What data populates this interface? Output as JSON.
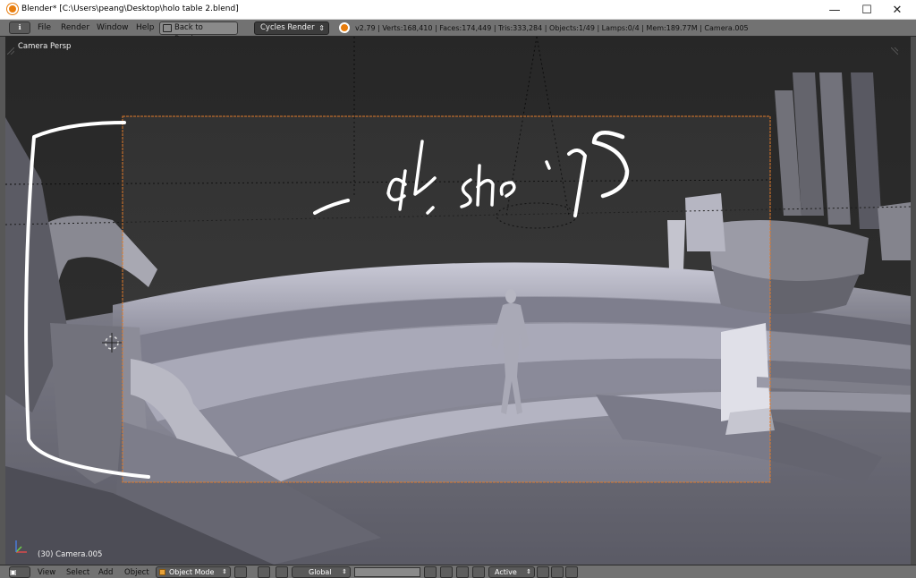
{
  "window": {
    "title": "Blender* [C:\\Users\\peang\\Desktop\\holo table 2.blend]",
    "minimize_glyph": "—",
    "maximize_glyph": "☐",
    "close_glyph": "✕"
  },
  "info_header": {
    "editor_type_glyph": "ℹ",
    "menus": [
      "File",
      "Render",
      "Window",
      "Help"
    ],
    "back_button": "Back to Previous",
    "render_engine": "Cycles Render",
    "stats": "v2.79 | Verts:168,410 | Faces:174,449 | Tris:333,284 | Objects:1/49 | Lamps:0/4 | Mem:189.77M | Camera.005"
  },
  "viewport": {
    "view_label": "Camera Persp",
    "object_label": "(30) Camera.005",
    "axis_colors": {
      "x": "#d94b4b",
      "y": "#6fcf4a",
      "z": "#4a7bd9"
    },
    "background_color": "#3b3b3b",
    "camera_frame_color": "#e07a2a",
    "annotation_color": "#ffffff"
  },
  "footer": {
    "menus": [
      "View",
      "Select",
      "Add",
      "Object"
    ],
    "mode": "Object Mode",
    "orientation": "Global",
    "pivot_select": "Active"
  },
  "icons": {
    "app": "blender-logo-icon",
    "editor_type": "info-icon",
    "viewport_shading": "solid-sphere-icon",
    "pivot": "pivot-point-icon",
    "manipulator": "manipulator-icon",
    "snap": "magnet-icon",
    "render_preview": "render-icon"
  }
}
